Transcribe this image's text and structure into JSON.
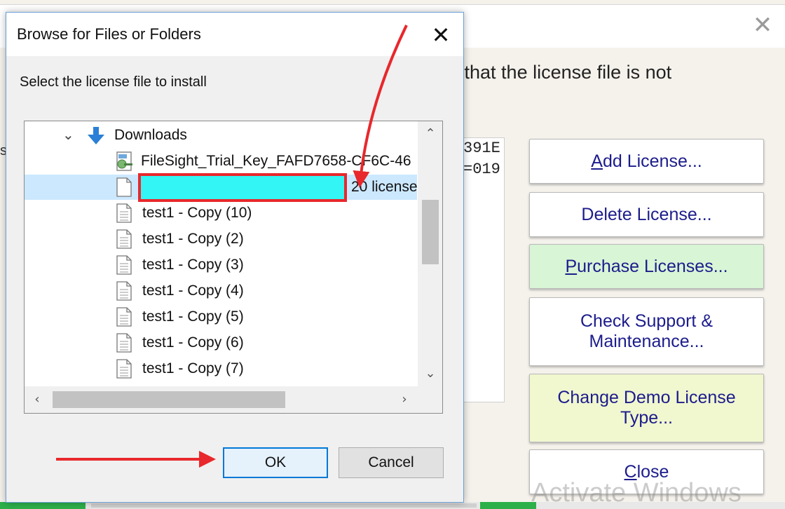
{
  "background_window": {
    "info_text": "e that the license file is not",
    "edge_text": "s",
    "listbox_lines": [
      "391E",
      "=019"
    ],
    "buttons": {
      "add_prefix": "",
      "add_accel": "A",
      "add_rest": "dd License...",
      "delete": "Delete License...",
      "purchase_accel": "P",
      "purchase_rest": "urchase Licenses...",
      "support_line1": "Check Support &",
      "support_line2": "Maintenance...",
      "demo_line1": "Change Demo License",
      "demo_line2": "Type...",
      "close_accel": "C",
      "close_rest": "lose"
    },
    "watermark": "Activate Windows",
    "colors": {
      "purchase_bg": "#d8f5d6",
      "demo_bg": "#f1f7cf",
      "button_text": "#1c1c8c"
    }
  },
  "dialog": {
    "title": "Browse for Files or Folders",
    "prompt": "Select the license file to install",
    "tree": {
      "folder": "Downloads",
      "items": [
        {
          "label": "FileSight_Trial_Key_FAFD7658-CF6C-46",
          "icon": "key-file-icon"
        },
        {
          "label": "20 license",
          "icon": "file-icon",
          "selected": true,
          "redacted": true
        },
        {
          "label": "test1 - Copy (10)",
          "icon": "text-file-icon"
        },
        {
          "label": "test1 - Copy (2)",
          "icon": "text-file-icon"
        },
        {
          "label": "test1 - Copy (3)",
          "icon": "text-file-icon"
        },
        {
          "label": "test1 - Copy (4)",
          "icon": "text-file-icon"
        },
        {
          "label": "test1 - Copy (5)",
          "icon": "text-file-icon"
        },
        {
          "label": "test1 - Copy (6)",
          "icon": "text-file-icon"
        },
        {
          "label": "test1 - Copy (7)",
          "icon": "text-file-icon"
        }
      ]
    },
    "ok_label": "OK",
    "cancel_label": "Cancel",
    "colors": {
      "selection": "#cce8ff",
      "redaction": "#33f5f5",
      "highlight_border": "#e8282c"
    }
  },
  "annotations": {
    "arrow_color": "#e8282c"
  }
}
